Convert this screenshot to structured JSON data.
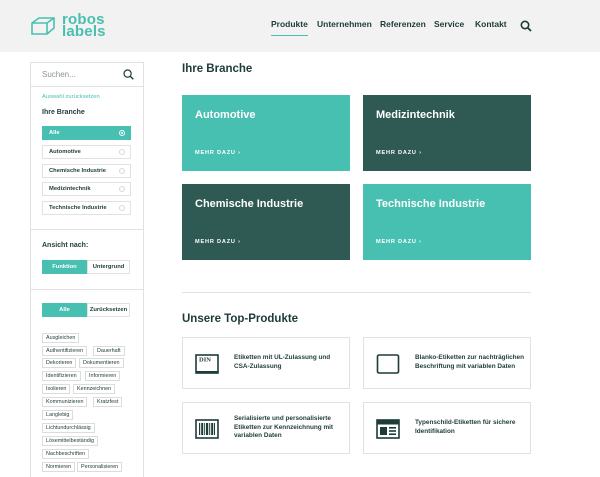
{
  "brand": {
    "line1": "robos",
    "line2": "labels"
  },
  "nav": {
    "items": [
      "Produkte",
      "Unternehmen",
      "Referenzen",
      "Service",
      "Kontakt"
    ],
    "active_index": 0
  },
  "sidebar": {
    "search_placeholder": "Suchen...",
    "reset_label": "Auswahl zurücksetzen",
    "branche_title": "Ihre Branche",
    "branche_options": [
      "Alle",
      "Automotive",
      "Chemische Industrie",
      "Medizintechnik",
      "Technische Industrie"
    ],
    "branche_selected": "Alle",
    "ansicht_title": "Ansicht nach:",
    "ansicht_options": [
      "Funktion",
      "Untergrund"
    ],
    "ansicht_selected": "Funktion",
    "filter_buttons": [
      "Alle",
      "Zurücksetzen"
    ],
    "tags": [
      "Ausgleichen",
      "Authentifizieren",
      "Dauerhaft",
      "Dekorieren",
      "Dokumentieren",
      "Identifizieren",
      "Informieren",
      "Isolieren",
      "Kennzeichnen",
      "Kommunizieren",
      "Kratzfest",
      "Langlebig",
      "Lichtundurchlässig",
      "Lösemittelbeständig",
      "Nachbeschriften",
      "Normieren",
      "Personalisieren"
    ]
  },
  "main": {
    "branche_heading": "Ihre Branche",
    "tiles": [
      {
        "title": "Automotive",
        "more": "MEHR DAZU ›",
        "style": "light"
      },
      {
        "title": "Medizintechnik",
        "more": "MEHR DAZU ›",
        "style": "dark"
      },
      {
        "title": "Chemische Industrie",
        "more": "MEHR DAZU ›",
        "style": "dark"
      },
      {
        "title": "Technische Industrie",
        "more": "MEHR DAZU ›",
        "style": "light"
      }
    ],
    "products_heading": "Unsere Top-Produkte",
    "products": [
      {
        "text": "Etiketten mit UL-Zulassung und CSA-Zulassung",
        "icon": "din-label-icon",
        "icon_text": "DIN"
      },
      {
        "text": "Blanko-Etiketten zur nachträglichen Beschriftung mit variablen Daten",
        "icon": "blank-label-icon"
      },
      {
        "text": "Serialisierte und personalisierte Etiketten zur Kennzeichnung mit variablen Daten",
        "icon": "barcode-icon"
      },
      {
        "text": "Typenschild-Etiketten für sichere Identifikation",
        "icon": "nameplate-icon"
      }
    ]
  },
  "colors": {
    "accent": "#48c0b1",
    "dark": "#2f5953",
    "text": "#1d3b38",
    "header_bg": "#f2f2f2",
    "border": "#e1e1e1"
  }
}
